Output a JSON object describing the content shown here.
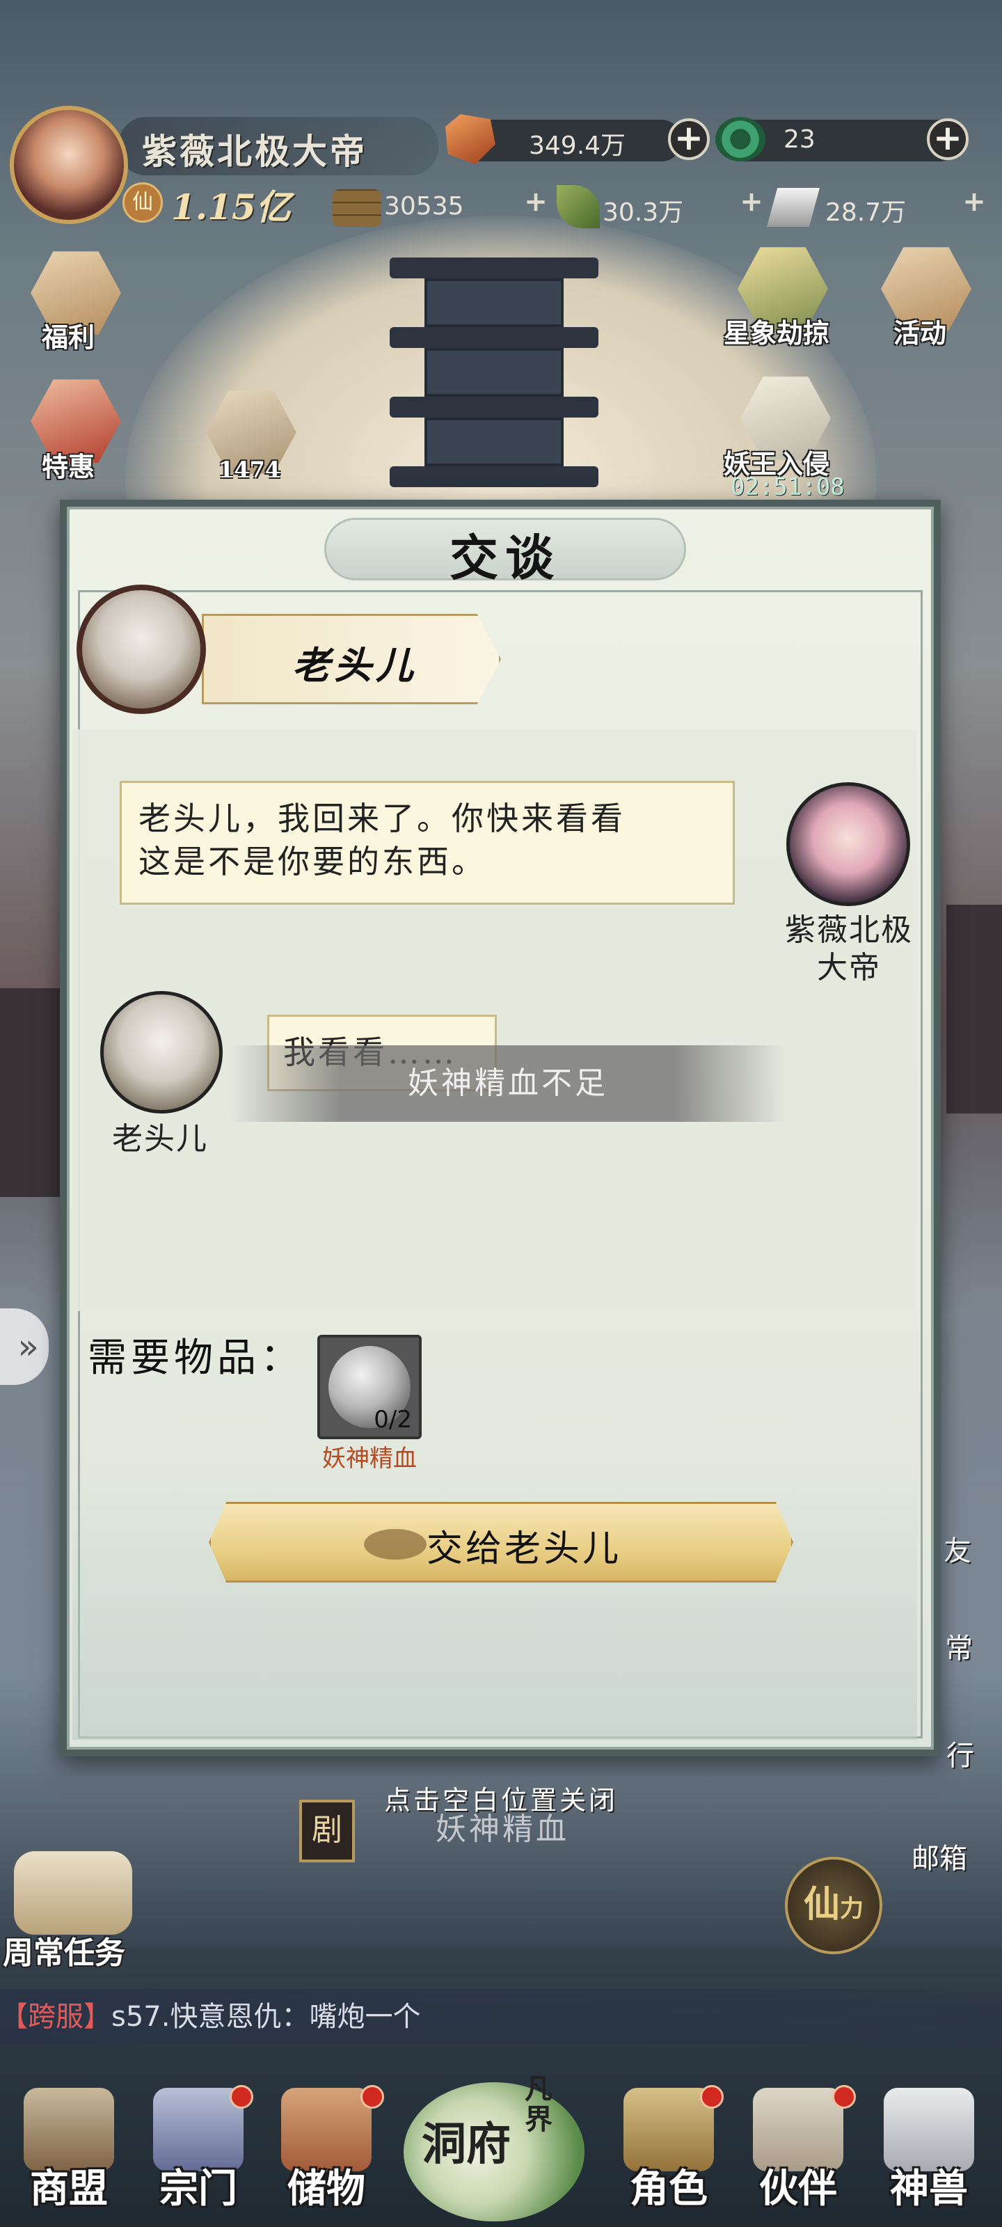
{
  "player": {
    "name": "紫薇北极大帝",
    "power_badge": "仙",
    "power": "1.15亿"
  },
  "resources": [
    {
      "icon": "red-gem-icon",
      "value": "349.4万"
    },
    {
      "icon": "jade-coin-icon",
      "value": "23"
    },
    {
      "icon": "wood-logs-icon",
      "value": "30535"
    },
    {
      "icon": "herb-leaf-icon",
      "value": "30.3万"
    },
    {
      "icon": "silver-ingot-icon",
      "value": "28.7万"
    }
  ],
  "side_menu": {
    "welfare": "福利",
    "special": "特惠",
    "gem_count": "1474",
    "star_event": "星象劫掠",
    "activity": "活动",
    "demon_invasion": "妖王入侵",
    "timer": "02:51:08"
  },
  "dialog": {
    "title": "交谈",
    "speaker_name": "老头儿",
    "messages": [
      {
        "text_line1": "老头儿，我回来了。你快来看看",
        "text_line2": "这是不是你要的东西。",
        "author_line1": "紫薇北极",
        "author_line2": "大帝"
      },
      {
        "text": "我看看……",
        "author": "老头儿"
      }
    ],
    "toast": "妖神精血不足",
    "required_label": "需要物品：",
    "item": {
      "name": "妖神精血",
      "count": "0/2"
    },
    "give_button": "交给老头儿"
  },
  "close_hint": "点击空白位置关闭",
  "story": {
    "tag": "剧",
    "text": "妖神精血"
  },
  "quest_label": "周常任务",
  "xian_label": "仙",
  "xian_sub": "力",
  "mail_label": "邮箱",
  "right_edge": {
    "friend": "友",
    "common": "常",
    "go": "行"
  },
  "chat_ticker": {
    "channel": "【跨服】",
    "message": "s57.快意恩仇：嘴炮一个"
  },
  "bottom_nav": {
    "alliance": "商盟",
    "sect": "宗门",
    "storage": "储物",
    "cave": "洞府",
    "mortal": "凡界",
    "character": "角色",
    "partner": "伙伴",
    "beast": "神兽"
  },
  "colors": {
    "dialog_border": "#4d5e5c",
    "button_gold": "#e9cf86",
    "item_name_red": "#b54a20",
    "ticker_channel": "#e35a5a"
  }
}
